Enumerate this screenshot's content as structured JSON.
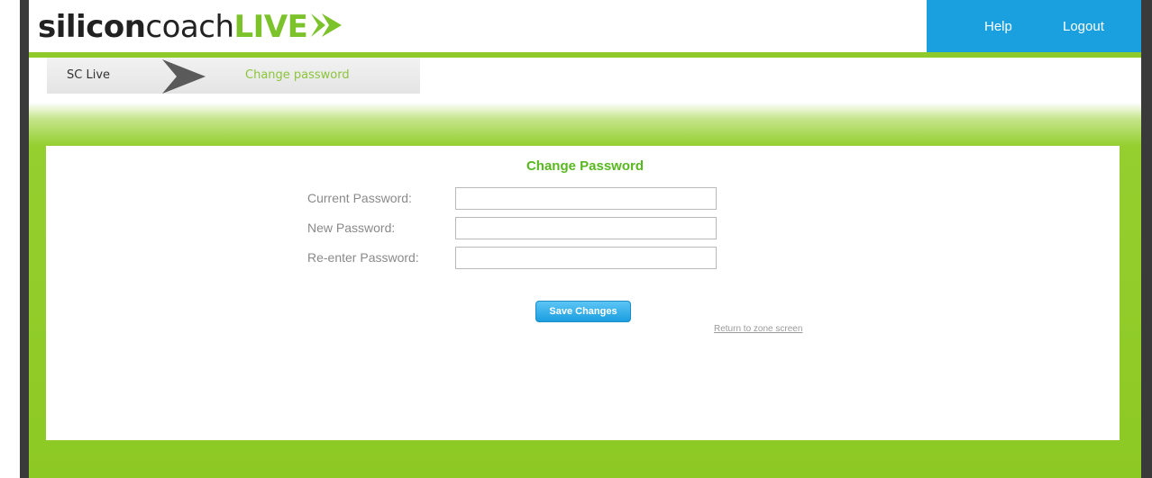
{
  "header": {
    "logo": {
      "part1": "silicon",
      "part2": "coach",
      "part3": "LIVE"
    },
    "nav": {
      "help": "Help",
      "logout": "Logout"
    }
  },
  "breadcrumb": {
    "home": "SC Live",
    "current": "Change password"
  },
  "form": {
    "title": "Change Password",
    "fields": [
      {
        "label": "Current Password:",
        "value": ""
      },
      {
        "label": "New Password:",
        "value": ""
      },
      {
        "label": "Re-enter Password:",
        "value": ""
      }
    ],
    "save_label": "Save Changes",
    "return_label": "Return to zone screen"
  },
  "colors": {
    "brand_green": "#8ecb2a",
    "nav_blue": "#1aa0de",
    "title_green": "#58b820",
    "button_blue": "#1b9ee0"
  }
}
